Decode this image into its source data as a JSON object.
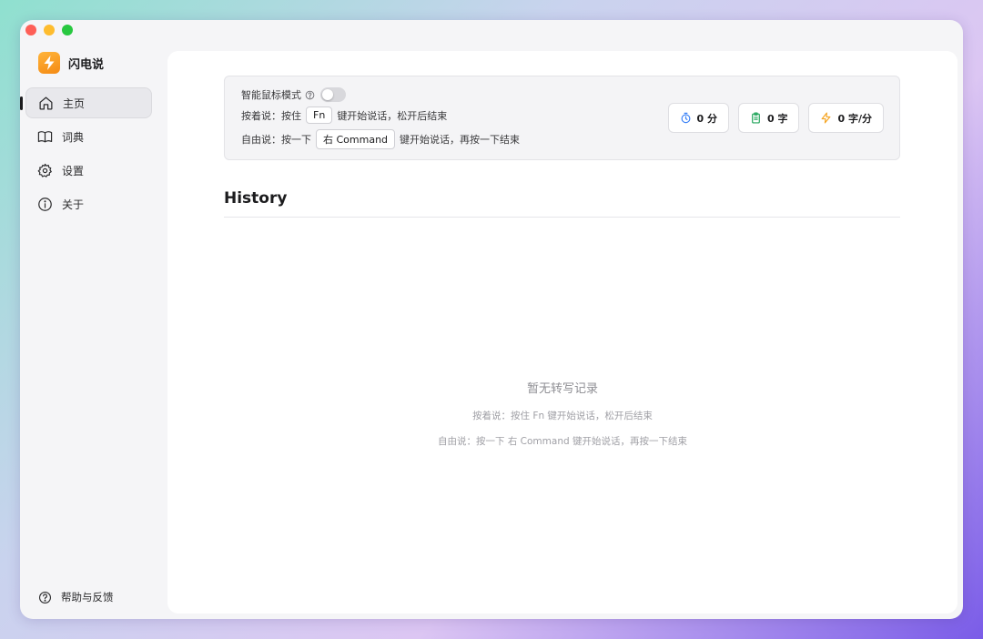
{
  "app": {
    "name": "闪电说"
  },
  "sidebar": {
    "items": [
      {
        "label": "主页",
        "icon": "home-icon",
        "active": true
      },
      {
        "label": "词典",
        "icon": "book-icon",
        "active": false
      },
      {
        "label": "设置",
        "icon": "gear-icon",
        "active": false
      },
      {
        "label": "关于",
        "icon": "info-icon",
        "active": false
      }
    ],
    "help_label": "帮助与反馈"
  },
  "panel": {
    "smart_mouse_label": "智能鼠标模式",
    "smart_mouse_enabled": false,
    "hold_prefix": "按着说：按住",
    "hold_key": "Fn",
    "hold_suffix": "键开始说话，松开后结束",
    "free_prefix": "自由说：按一下",
    "free_key": "右 Command",
    "free_suffix": "键开始说话，再按一下结束"
  },
  "stats": {
    "minutes": "0 分",
    "chars": "0 字",
    "speed": "0 字/分",
    "colors": {
      "minutes": "#3b82f6",
      "chars": "#22a55b",
      "speed": "#f5a524"
    }
  },
  "history": {
    "title": "History",
    "empty_title": "暂无转写记录",
    "empty_hold": "按着说：按住 Fn 键开始说话，松开后结束",
    "empty_free": "自由说：按一下 右 Command 键开始说话，再按一下结束"
  }
}
